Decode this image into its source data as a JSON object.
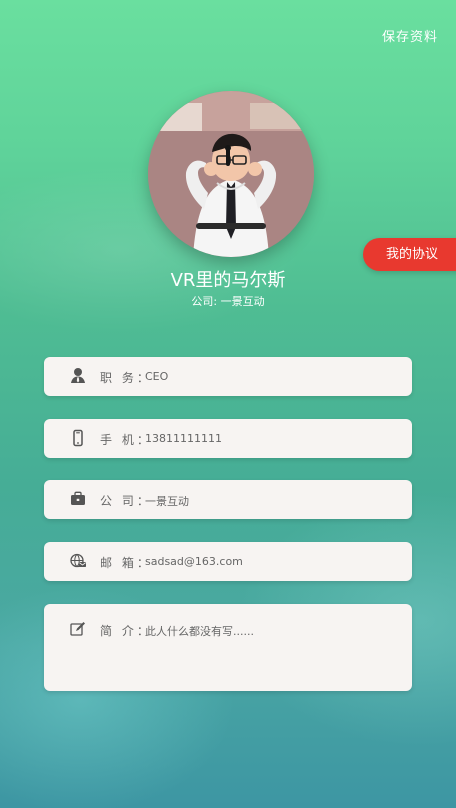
{
  "header": {
    "save_label": "保存资料"
  },
  "profile": {
    "name": "VR里的马尔斯",
    "company_line": "公司: 一景互动"
  },
  "protocol_button": {
    "label": "我的协议"
  },
  "fields": {
    "position": {
      "label": "职 务：",
      "value": "CEO",
      "icon": "user-icon"
    },
    "phone": {
      "label": "手 机：",
      "value": "13811111111",
      "icon": "phone-icon"
    },
    "company": {
      "label": "公 司：",
      "value": "一景互动",
      "icon": "briefcase-icon"
    },
    "email": {
      "label": "邮 箱：",
      "value": "sadsad@163.com",
      "icon": "globe-mail-icon"
    },
    "bio": {
      "label": "简 介：",
      "value": "此人什么都没有写......",
      "icon": "edit-icon"
    }
  },
  "colors": {
    "background_top": "#6adf9f",
    "background_bottom": "#3d96a3",
    "protocol_button": "#e8392f",
    "card_background": "#f7f4f2",
    "text_gray": "#666666"
  }
}
